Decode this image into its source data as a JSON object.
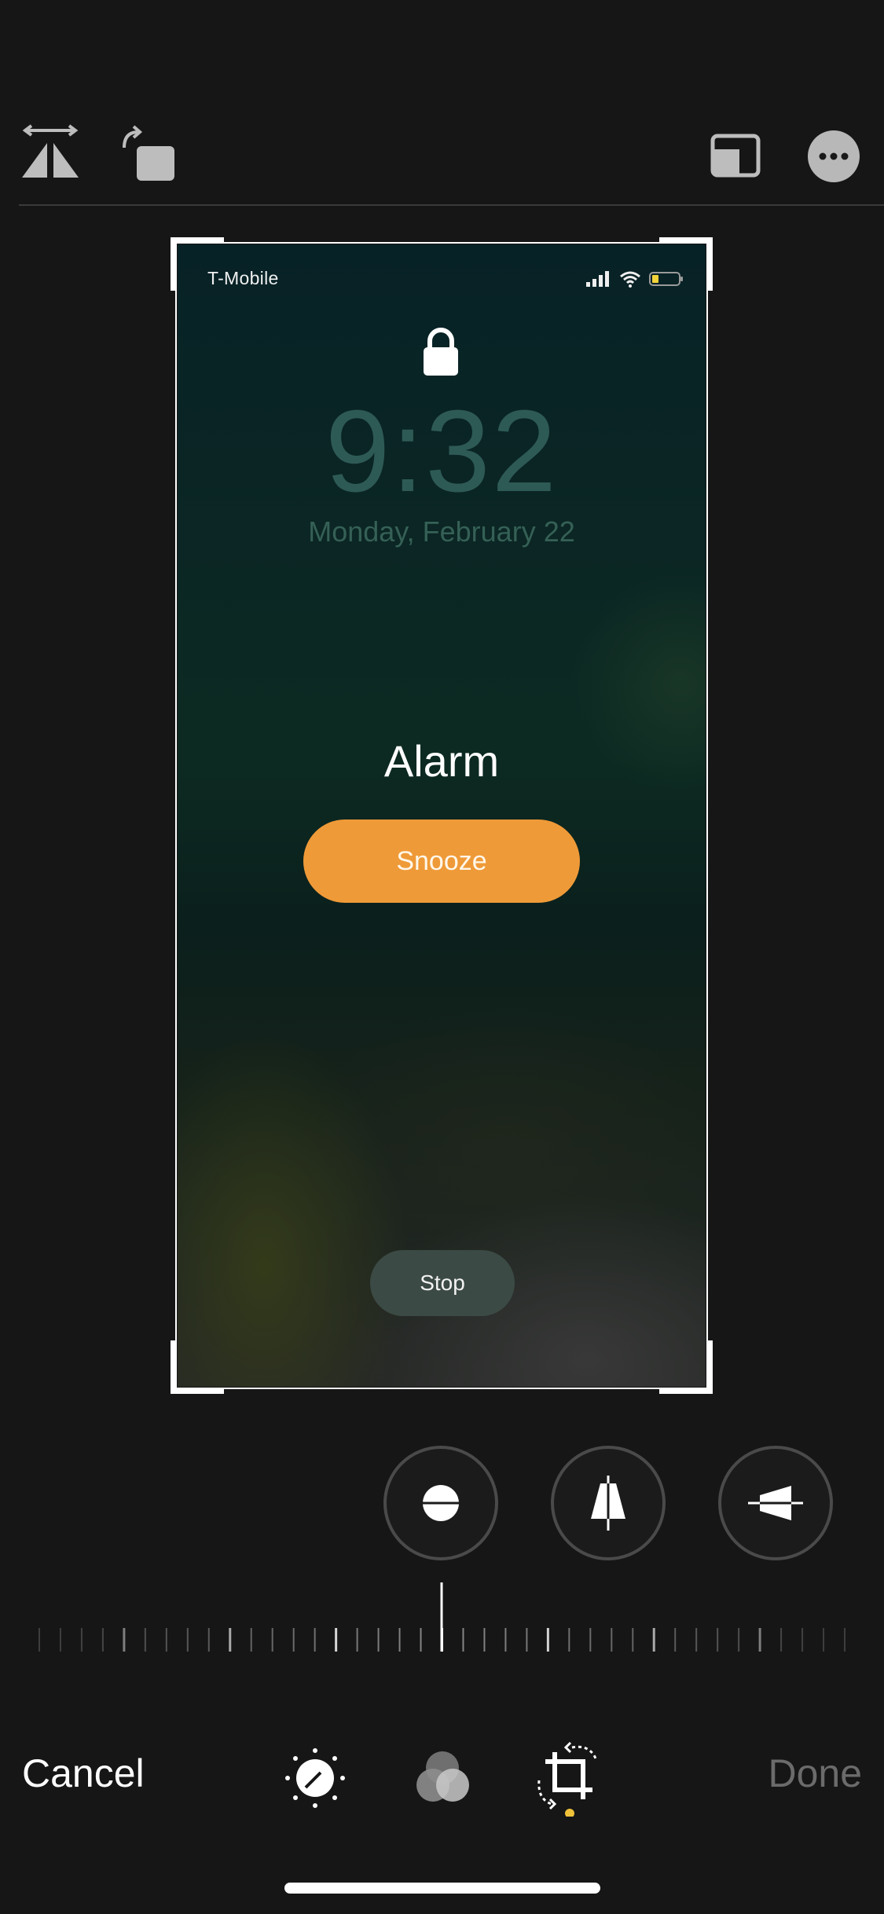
{
  "toolbar": {
    "flip_icon": "flip-horizontal-icon",
    "rotate_icon": "rotate-icon",
    "aspect_icon": "aspect-ratio-icon",
    "more_icon": "more-icon"
  },
  "photo": {
    "carrier": "T-Mobile",
    "time": "9:32",
    "date": "Monday, February 22",
    "alarm_title": "Alarm",
    "snooze_label": "Snooze",
    "stop_label": "Stop",
    "battery_color": "#f2d43a"
  },
  "adjustments": [
    {
      "name": "straighten",
      "icon": "straighten-icon"
    },
    {
      "name": "vertical",
      "icon": "vertical-perspective-icon"
    },
    {
      "name": "horizontal",
      "icon": "horizontal-perspective-icon"
    }
  ],
  "bottom_bar": {
    "cancel_label": "Cancel",
    "done_label": "Done",
    "tools": [
      "adjust-icon",
      "filters-icon",
      "crop-icon"
    ],
    "active_tool": "crop",
    "active_dot_color": "#f0c23a"
  },
  "colors": {
    "background": "#161616",
    "accent": "#ef9a38"
  }
}
